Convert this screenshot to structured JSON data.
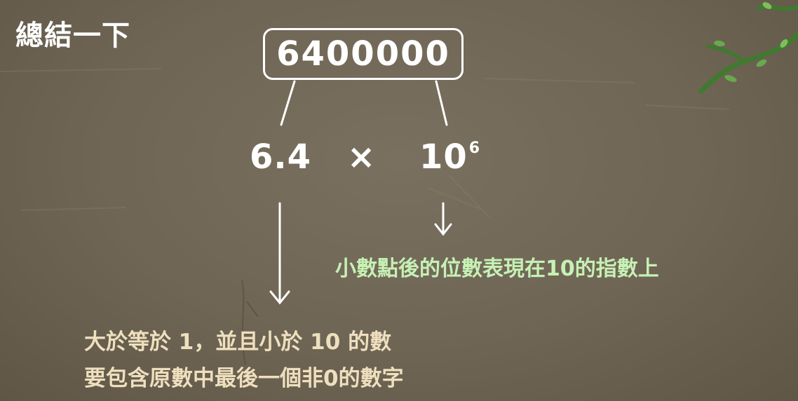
{
  "title": "總結一下",
  "original_number": "6400000",
  "coefficient": "6.4",
  "times_sign": "×",
  "base": "10",
  "exponent": "6",
  "exponent_note": "小數點後的位數表現在10的指數上",
  "coefficient_notes": [
    "大於等於 1，並且小於 10 的數",
    "要包含原數中最後一個非0的數字"
  ],
  "colors": {
    "background": "#6f6555",
    "text": "#ffffff",
    "exponent_note": "#c6f1b4",
    "coefficient_note": "#eedfbe",
    "vine": "#3f7a2e"
  },
  "icons": [
    "vine-decoration-icon",
    "down-arrow-icon"
  ]
}
